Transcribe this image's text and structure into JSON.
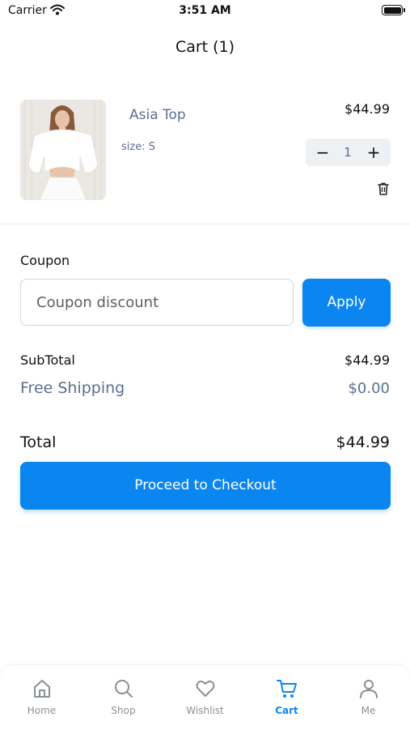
{
  "status_bar": {
    "carrier": "Carrier",
    "time": "3:51 AM"
  },
  "header": {
    "title": "Cart (1)"
  },
  "cart_item": {
    "name": "Asia Top",
    "size": "size: S",
    "price": "$44.99",
    "quantity": "1",
    "minus": "−",
    "plus": "+"
  },
  "coupon": {
    "label": "Coupon",
    "placeholder": "Coupon discount",
    "value": "",
    "apply_label": "Apply"
  },
  "summary": {
    "subtotal_label": "SubTotal",
    "subtotal_value": "$44.99",
    "shipping_label": "Free Shipping",
    "shipping_value": "$0.00",
    "total_label": "Total",
    "total_value": "$44.99"
  },
  "checkout_label": "Proceed to Checkout",
  "tabs": [
    {
      "label": "Home",
      "icon": "home-icon",
      "active": false
    },
    {
      "label": "Shop",
      "icon": "search-icon",
      "active": false
    },
    {
      "label": "Wishlist",
      "icon": "heart-icon",
      "active": false
    },
    {
      "label": "Cart",
      "icon": "cart-icon",
      "active": true
    },
    {
      "label": "Me",
      "icon": "user-icon",
      "active": false
    }
  ],
  "colors": {
    "accent": "#0b86f0",
    "muted_text": "#5a6f92",
    "inactive_tab": "#8a8f96"
  }
}
